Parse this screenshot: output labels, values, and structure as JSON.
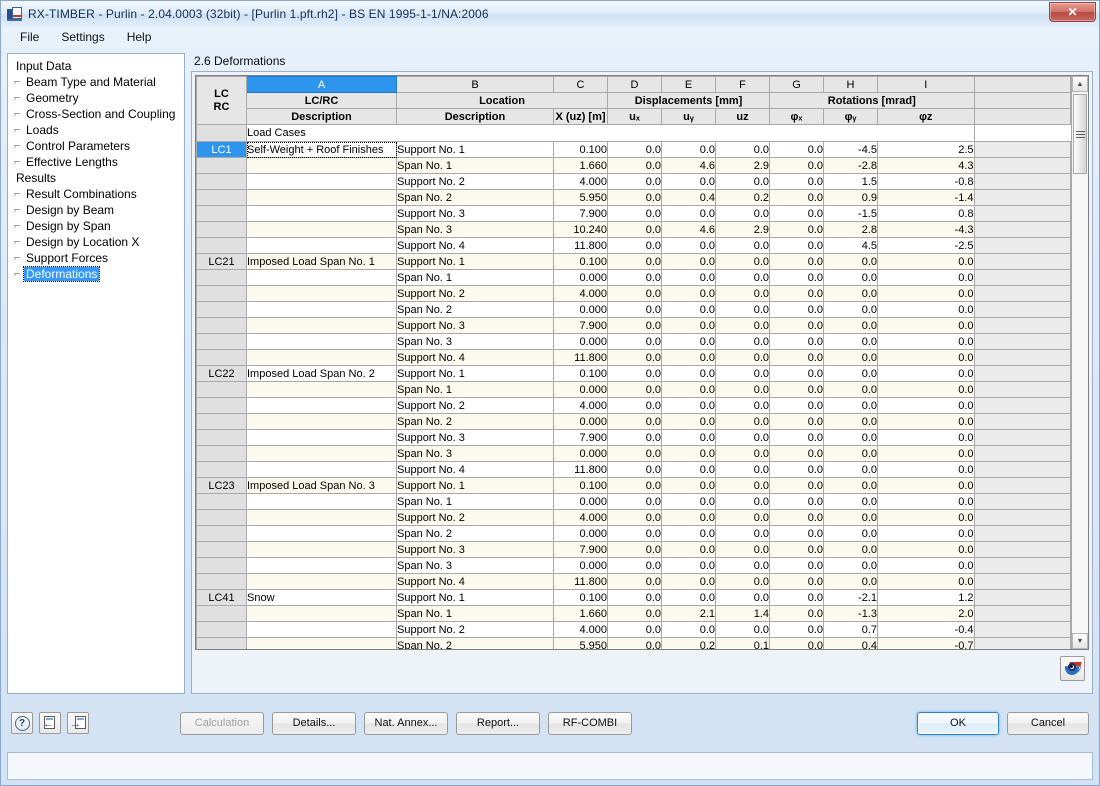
{
  "window": {
    "title": "RX-TIMBER - Purlin - 2.04.0003 (32bit) - [Purlin 1.pft.rh2] - BS EN 1995-1-1/NA:2006",
    "close_label": "✕"
  },
  "menu": {
    "items": [
      "File",
      "Settings",
      "Help"
    ]
  },
  "sidebar": {
    "groups": [
      {
        "label": "Input Data",
        "items": [
          "Beam Type and Material",
          "Geometry",
          "Cross-Section and Coupling",
          "Loads",
          "Control Parameters",
          "Effective Lengths"
        ]
      },
      {
        "label": "Results",
        "items": [
          "Result Combinations",
          "Design by Beam",
          "Design by Span",
          "Design by Location X",
          "Support Forces",
          "Deformations"
        ]
      }
    ],
    "selected": "Deformations"
  },
  "panel": {
    "title": "2.6 Deformations"
  },
  "table": {
    "column_letters": [
      "A",
      "B",
      "C",
      "D",
      "E",
      "F",
      "G",
      "H",
      "I"
    ],
    "selected_letter": "A",
    "corner": {
      "line1": "LC",
      "line2": "RC"
    },
    "group_headers": {
      "a": "LC/RC",
      "b": "Location",
      "displacements": "Displacements [mm]",
      "rotations": "Rotations [mrad]"
    },
    "sub_headers": {
      "a": "Description",
      "b": "Description",
      "c": "X (uᴢ) [m]",
      "d": "uₓ",
      "e": "uᵧ",
      "f": "uᴢ",
      "g": "φₓ",
      "h": "φᵧ",
      "i": "φᴢ"
    },
    "section_label": "Load Cases",
    "blocks": [
      {
        "lc": "LC1",
        "description": "Self-Weight + Roof Finishes",
        "highlight": true,
        "rows": [
          {
            "location": "Support No. 1",
            "x": "0.100",
            "ux": "0.0",
            "uy": "0.0",
            "uz": "0.0",
            "phix": "0.0",
            "phiy": "-4.5",
            "phiz": "2.5"
          },
          {
            "location": "Span No. 1",
            "x": "1.660",
            "ux": "0.0",
            "uy": "4.6",
            "uz": "2.9",
            "phix": "0.0",
            "phiy": "-2.8",
            "phiz": "4.3"
          },
          {
            "location": "Support No. 2",
            "x": "4.000",
            "ux": "0.0",
            "uy": "0.0",
            "uz": "0.0",
            "phix": "0.0",
            "phiy": "1.5",
            "phiz": "-0.8"
          },
          {
            "location": "Span No. 2",
            "x": "5.950",
            "ux": "0.0",
            "uy": "0.4",
            "uz": "0.2",
            "phix": "0.0",
            "phiy": "0.9",
            "phiz": "-1.4"
          },
          {
            "location": "Support No. 3",
            "x": "7.900",
            "ux": "0.0",
            "uy": "0.0",
            "uz": "0.0",
            "phix": "0.0",
            "phiy": "-1.5",
            "phiz": "0.8"
          },
          {
            "location": "Span No. 3",
            "x": "10.240",
            "ux": "0.0",
            "uy": "4.6",
            "uz": "2.9",
            "phix": "0.0",
            "phiy": "2.8",
            "phiz": "-4.3"
          },
          {
            "location": "Support No. 4",
            "x": "11.800",
            "ux": "0.0",
            "uy": "0.0",
            "uz": "0.0",
            "phix": "0.0",
            "phiy": "4.5",
            "phiz": "-2.5"
          }
        ]
      },
      {
        "lc": "LC21",
        "description": "Imposed Load Span No. 1",
        "highlight": false,
        "rows": [
          {
            "location": "Support No. 1",
            "x": "0.100",
            "ux": "0.0",
            "uy": "0.0",
            "uz": "0.0",
            "phix": "0.0",
            "phiy": "0.0",
            "phiz": "0.0"
          },
          {
            "location": "Span No. 1",
            "x": "0.000",
            "ux": "0.0",
            "uy": "0.0",
            "uz": "0.0",
            "phix": "0.0",
            "phiy": "0.0",
            "phiz": "0.0"
          },
          {
            "location": "Support No. 2",
            "x": "4.000",
            "ux": "0.0",
            "uy": "0.0",
            "uz": "0.0",
            "phix": "0.0",
            "phiy": "0.0",
            "phiz": "0.0"
          },
          {
            "location": "Span No. 2",
            "x": "0.000",
            "ux": "0.0",
            "uy": "0.0",
            "uz": "0.0",
            "phix": "0.0",
            "phiy": "0.0",
            "phiz": "0.0"
          },
          {
            "location": "Support No. 3",
            "x": "7.900",
            "ux": "0.0",
            "uy": "0.0",
            "uz": "0.0",
            "phix": "0.0",
            "phiy": "0.0",
            "phiz": "0.0"
          },
          {
            "location": "Span No. 3",
            "x": "0.000",
            "ux": "0.0",
            "uy": "0.0",
            "uz": "0.0",
            "phix": "0.0",
            "phiy": "0.0",
            "phiz": "0.0"
          },
          {
            "location": "Support No. 4",
            "x": "11.800",
            "ux": "0.0",
            "uy": "0.0",
            "uz": "0.0",
            "phix": "0.0",
            "phiy": "0.0",
            "phiz": "0.0"
          }
        ]
      },
      {
        "lc": "LC22",
        "description": "Imposed Load Span No. 2",
        "highlight": false,
        "rows": [
          {
            "location": "Support No. 1",
            "x": "0.100",
            "ux": "0.0",
            "uy": "0.0",
            "uz": "0.0",
            "phix": "0.0",
            "phiy": "0.0",
            "phiz": "0.0"
          },
          {
            "location": "Span No. 1",
            "x": "0.000",
            "ux": "0.0",
            "uy": "0.0",
            "uz": "0.0",
            "phix": "0.0",
            "phiy": "0.0",
            "phiz": "0.0"
          },
          {
            "location": "Support No. 2",
            "x": "4.000",
            "ux": "0.0",
            "uy": "0.0",
            "uz": "0.0",
            "phix": "0.0",
            "phiy": "0.0",
            "phiz": "0.0"
          },
          {
            "location": "Span No. 2",
            "x": "0.000",
            "ux": "0.0",
            "uy": "0.0",
            "uz": "0.0",
            "phix": "0.0",
            "phiy": "0.0",
            "phiz": "0.0"
          },
          {
            "location": "Support No. 3",
            "x": "7.900",
            "ux": "0.0",
            "uy": "0.0",
            "uz": "0.0",
            "phix": "0.0",
            "phiy": "0.0",
            "phiz": "0.0"
          },
          {
            "location": "Span No. 3",
            "x": "0.000",
            "ux": "0.0",
            "uy": "0.0",
            "uz": "0.0",
            "phix": "0.0",
            "phiy": "0.0",
            "phiz": "0.0"
          },
          {
            "location": "Support No. 4",
            "x": "11.800",
            "ux": "0.0",
            "uy": "0.0",
            "uz": "0.0",
            "phix": "0.0",
            "phiy": "0.0",
            "phiz": "0.0"
          }
        ]
      },
      {
        "lc": "LC23",
        "description": "Imposed Load Span No. 3",
        "highlight": false,
        "rows": [
          {
            "location": "Support No. 1",
            "x": "0.100",
            "ux": "0.0",
            "uy": "0.0",
            "uz": "0.0",
            "phix": "0.0",
            "phiy": "0.0",
            "phiz": "0.0"
          },
          {
            "location": "Span No. 1",
            "x": "0.000",
            "ux": "0.0",
            "uy": "0.0",
            "uz": "0.0",
            "phix": "0.0",
            "phiy": "0.0",
            "phiz": "0.0"
          },
          {
            "location": "Support No. 2",
            "x": "4.000",
            "ux": "0.0",
            "uy": "0.0",
            "uz": "0.0",
            "phix": "0.0",
            "phiy": "0.0",
            "phiz": "0.0"
          },
          {
            "location": "Span No. 2",
            "x": "0.000",
            "ux": "0.0",
            "uy": "0.0",
            "uz": "0.0",
            "phix": "0.0",
            "phiy": "0.0",
            "phiz": "0.0"
          },
          {
            "location": "Support No. 3",
            "x": "7.900",
            "ux": "0.0",
            "uy": "0.0",
            "uz": "0.0",
            "phix": "0.0",
            "phiy": "0.0",
            "phiz": "0.0"
          },
          {
            "location": "Span No. 3",
            "x": "0.000",
            "ux": "0.0",
            "uy": "0.0",
            "uz": "0.0",
            "phix": "0.0",
            "phiy": "0.0",
            "phiz": "0.0"
          },
          {
            "location": "Support No. 4",
            "x": "11.800",
            "ux": "0.0",
            "uy": "0.0",
            "uz": "0.0",
            "phix": "0.0",
            "phiy": "0.0",
            "phiz": "0.0"
          }
        ]
      },
      {
        "lc": "LC41",
        "description": "Snow",
        "highlight": false,
        "rows": [
          {
            "location": "Support No. 1",
            "x": "0.100",
            "ux": "0.0",
            "uy": "0.0",
            "uz": "0.0",
            "phix": "0.0",
            "phiy": "-2.1",
            "phiz": "1.2"
          },
          {
            "location": "Span No. 1",
            "x": "1.660",
            "ux": "0.0",
            "uy": "2.1",
            "uz": "1.4",
            "phix": "0.0",
            "phiy": "-1.3",
            "phiz": "2.0"
          },
          {
            "location": "Support No. 2",
            "x": "4.000",
            "ux": "0.0",
            "uy": "0.0",
            "uz": "0.0",
            "phix": "0.0",
            "phiy": "0.7",
            "phiz": "-0.4"
          },
          {
            "location": "Span No. 2",
            "x": "5.950",
            "ux": "0.0",
            "uy": "0.2",
            "uz": "0.1",
            "phix": "0.0",
            "phiy": "0.4",
            "phiz": "-0.7"
          }
        ]
      }
    ]
  },
  "footer": {
    "icon_buttons": [
      "help-icon",
      "previous-icon",
      "next-icon"
    ],
    "help_glyph": "?",
    "prev_glyph": "←",
    "next_glyph": "→",
    "buttons": [
      {
        "label": "Calculation",
        "disabled": true
      },
      {
        "label": "Details...",
        "disabled": false
      },
      {
        "label": "Nat. Annex...",
        "disabled": false
      },
      {
        "label": "Report...",
        "disabled": false
      },
      {
        "label": "RF-COMBI",
        "disabled": false
      }
    ],
    "ok_label": "OK",
    "cancel_label": "Cancel"
  },
  "scrollbar": {
    "up_glyph": "▲",
    "down_glyph": "▼"
  }
}
